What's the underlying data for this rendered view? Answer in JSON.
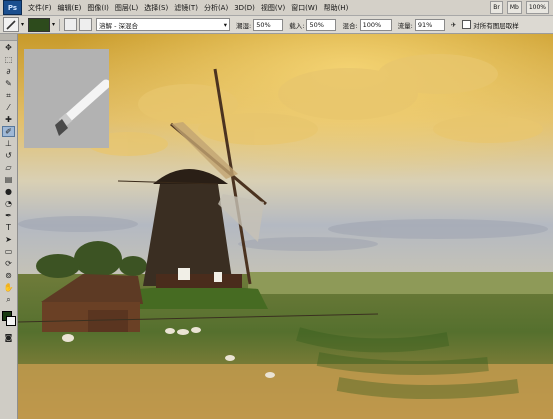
{
  "menubar": {
    "logo": "Ps",
    "items": [
      "文件(F)",
      "编辑(E)",
      "图像(I)",
      "图层(L)",
      "选择(S)",
      "滤镜(T)",
      "分析(A)",
      "3D(D)",
      "视图(V)",
      "窗口(W)",
      "帮助(H)"
    ],
    "right_items": [
      "Br",
      "Mb",
      "100%"
    ]
  },
  "options": {
    "mode_label": "画笔 - 模式:",
    "mode_value": "溶解 - 深混合",
    "opacity_label": "混合:",
    "opacity_value": "50%",
    "flow_label": "载入:",
    "flow_value": "50%",
    "mix_label": "混合:",
    "mix_value": "100%",
    "flow2_label": "流量:",
    "flow2_value": "91%",
    "all_layers_label": "对所有图层取样"
  },
  "colors": {
    "foreground": "#183a10",
    "background": "#f4f4f4"
  },
  "icons": [
    "move-icon",
    "marquee-icon",
    "lasso-icon",
    "quick-select-icon",
    "crop-icon",
    "eyedropper-icon",
    "healing-icon",
    "mixer-brush-icon",
    "clone-stamp-icon",
    "history-brush-icon",
    "eraser-icon",
    "gradient-icon",
    "blur-icon",
    "dodge-icon",
    "pen-icon",
    "type-icon",
    "path-select-icon",
    "shape-icon",
    "3d-rotate-icon",
    "3d-orbit-icon",
    "hand-icon",
    "zoom-icon"
  ]
}
